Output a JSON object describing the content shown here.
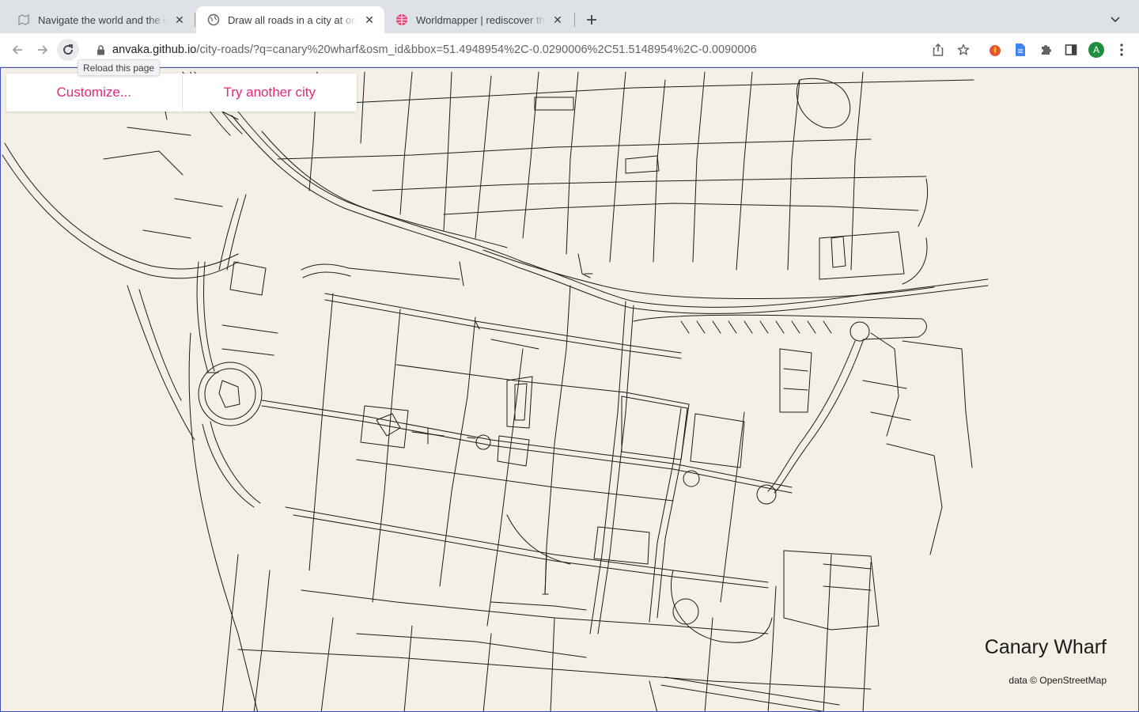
{
  "browser": {
    "tabs": [
      {
        "title": "Navigate the world and the city",
        "active": false,
        "favicon": "map-favicon"
      },
      {
        "title": "Draw all roads in a city at once",
        "active": true,
        "favicon": "globe-favicon"
      },
      {
        "title": "Worldmapper | rediscover the world",
        "active": false,
        "favicon": "worldmapper-favicon"
      }
    ],
    "address": {
      "host": "anvaka.github.io",
      "path": "/city-roads/?q=canary%20wharf&osm_id&bbox=51.4948954%2C-0.0290006%2C51.5148954%2C-0.0090006"
    },
    "tooltip": "Reload this page",
    "avatar_letter": "A",
    "colors": {
      "accent": "#e5287c",
      "map_background": "#f4f0e6",
      "roads": "#1b1b1b"
    }
  },
  "page": {
    "customize_label": "Customize...",
    "try_another_label": "Try another city",
    "city_name": "Canary Wharf",
    "attribution": "data © OpenStreetMap"
  }
}
